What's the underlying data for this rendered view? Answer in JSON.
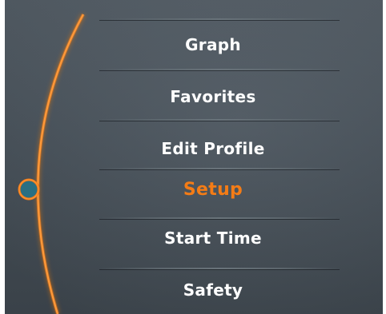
{
  "menu": {
    "items": [
      {
        "label": "Graph",
        "selected": false
      },
      {
        "label": "Favorites",
        "selected": false
      },
      {
        "label": "Edit Profile",
        "selected": false
      },
      {
        "label": "Setup",
        "selected": true
      },
      {
        "label": "Start Time",
        "selected": false
      },
      {
        "label": "Safety",
        "selected": false
      }
    ]
  },
  "colors": {
    "accent": "#f47c16",
    "text": "#ffffff",
    "background": "#474f57",
    "indicator_fill": "#2a6f82"
  }
}
